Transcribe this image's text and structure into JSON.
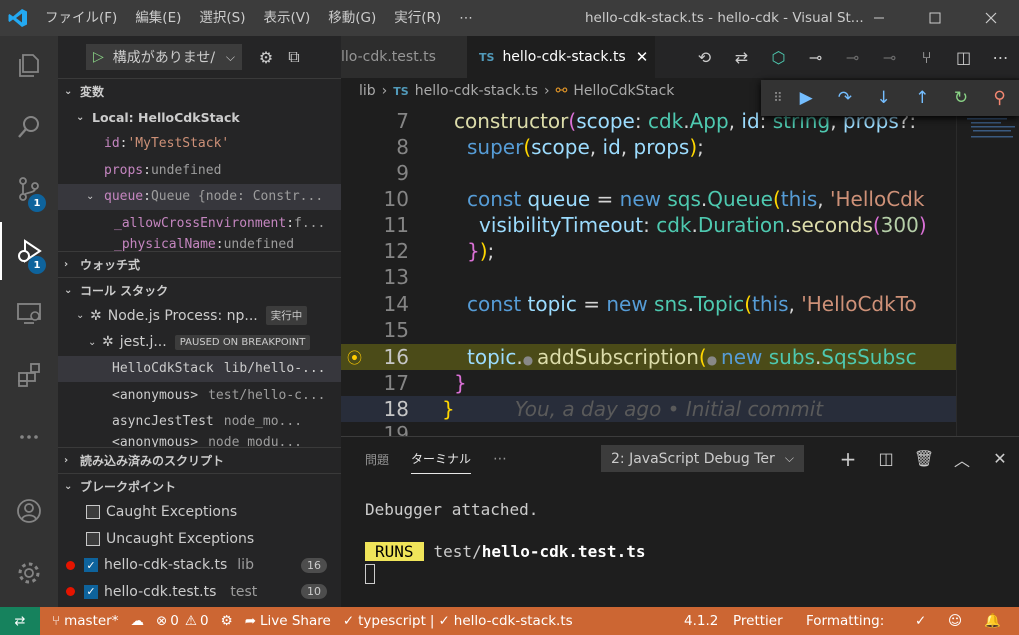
{
  "titlebar": {
    "logo_icon": "vscode-logo-icon",
    "menu": [
      "ファイル(F)",
      "編集(E)",
      "選択(S)",
      "表示(V)",
      "移動(G)",
      "実行(R)",
      "⋯"
    ],
    "title": "hello-cdk-stack.ts - hello-cdk - Visual St..."
  },
  "activity_badges": {
    "scm": "1",
    "debug": "1"
  },
  "sidebar": {
    "config_label": "構成がありませ/",
    "variables_header": "変数",
    "local_scope": "Local: HelloCdkStack",
    "vars": [
      {
        "name": "id",
        "value": "'MyTestStack'"
      },
      {
        "name": "props",
        "value": "undefined"
      },
      {
        "name": "queue",
        "value": "Queue {node: Constr..."
      },
      {
        "name": "_allowCrossEnvironment",
        "value": "f..."
      },
      {
        "name": "_physicalName",
        "value": "undefined"
      }
    ],
    "watch_header": "ウォッチ式",
    "callstack_header": "コール スタック",
    "process_label": "Node.js Process: np...",
    "process_state": "実行中",
    "jest_label": "jest.j...",
    "jest_state": "PAUSED ON BREAKPOINT",
    "frames": [
      {
        "fn": "HelloCdkStack",
        "file": "lib/hello-..."
      },
      {
        "fn": "<anonymous>",
        "file": "test/hello-c..."
      },
      {
        "fn": "asyncJestTest",
        "file": "node_mo..."
      },
      {
        "fn": "<anonymous>",
        "file": "node_modu..."
      }
    ],
    "scripts_header": "読み込み済みのスクリプト",
    "breakpoints_header": "ブレークポイント",
    "exceptions": [
      "Caught Exceptions",
      "Uncaught Exceptions"
    ],
    "breakpoints": [
      {
        "file": "hello-cdk-stack.ts",
        "dir": "lib",
        "line": "16"
      },
      {
        "file": "hello-cdk.test.ts",
        "dir": "test",
        "line": "10"
      }
    ]
  },
  "tabs": [
    {
      "label": "llo-cdk.test.ts"
    },
    {
      "label": "hello-cdk-stack.ts"
    }
  ],
  "breadcrumb": [
    "lib",
    "hello-cdk-stack.ts",
    "HelloCdkStack"
  ],
  "code": {
    "line_numbers": [
      "7",
      "8",
      "9",
      "10",
      "11",
      "12",
      "13",
      "14",
      "15",
      "16",
      "17",
      "18",
      "19"
    ],
    "blame": "You, a day ago • Initial commit"
  },
  "panel": {
    "tab_problems": "問題",
    "tab_terminal": "ターミナル",
    "tab_more": "⋯",
    "terminal_select": "2: JavaScript Debug Ter",
    "line1": "Debugger attached.",
    "runs": "RUNS",
    "test_dir": "test/",
    "test_file": "hello-cdk.test.ts"
  },
  "status": {
    "branch": "master*",
    "errors": "0",
    "warnings": "0",
    "live_share": "Live Share",
    "language": "typescript",
    "file": "hello-cdk-stack.ts",
    "version": "4.1.2",
    "prettier": "Prettier",
    "formatting": "Formatting:"
  }
}
